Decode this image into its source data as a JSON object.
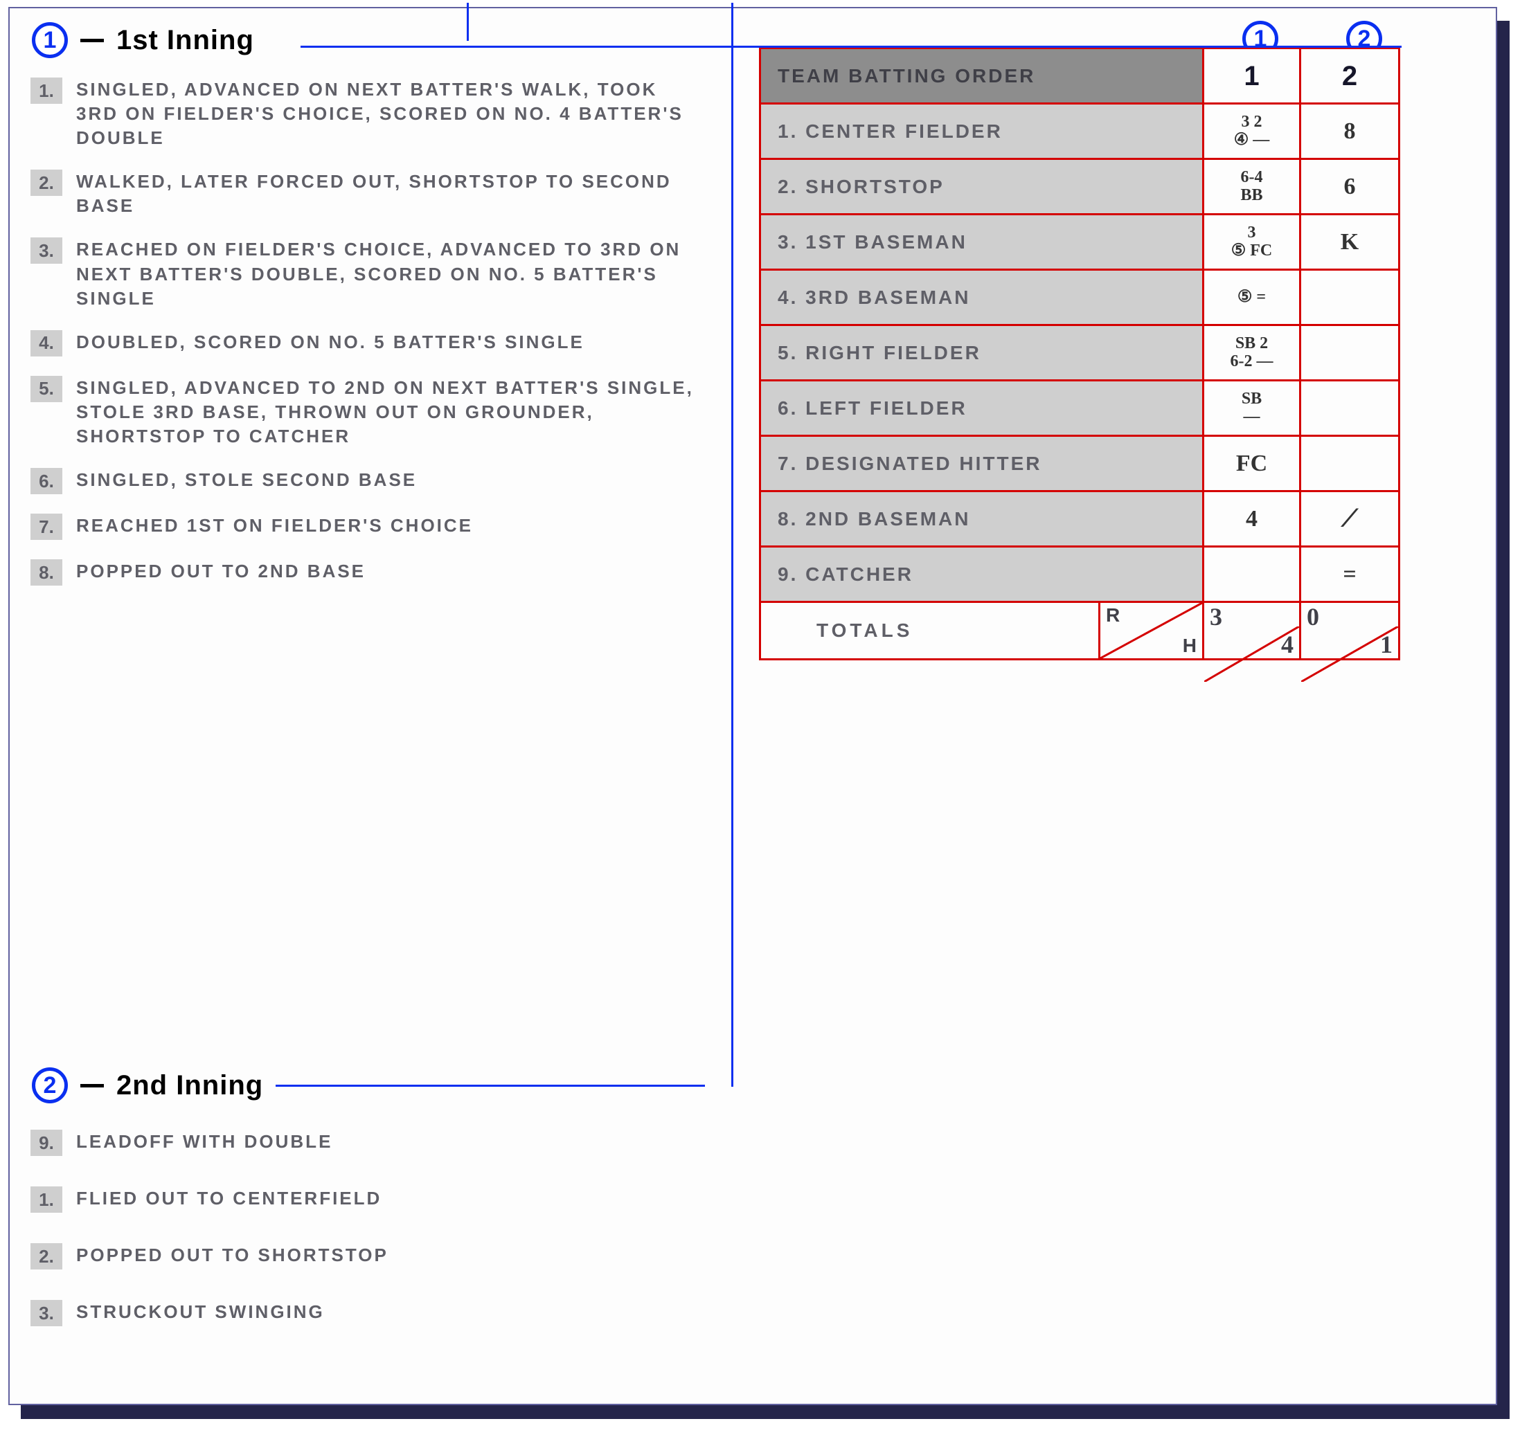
{
  "innings": [
    {
      "badge": "1",
      "title": "1st Inning",
      "plays": [
        {
          "n": "1.",
          "t": "SINGLED, ADVANCED ON NEXT BATTER'S WALK, TOOK 3RD ON FIELDER'S CHOICE, SCORED ON NO. 4 BATTER'S DOUBLE"
        },
        {
          "n": "2.",
          "t": "WALKED, LATER FORCED OUT, SHORTSTOP TO SECOND BASE"
        },
        {
          "n": "3.",
          "t": "REACHED ON FIELDER'S CHOICE, ADVANCED TO 3RD ON NEXT BATTER'S DOUBLE, SCORED ON NO. 5 BATTER'S SINGLE"
        },
        {
          "n": "4.",
          "t": "DOUBLED, SCORED ON NO. 5 BATTER'S SINGLE"
        },
        {
          "n": "5.",
          "t": "SINGLED, ADVANCED TO 2ND ON NEXT BATTER'S SINGLE, STOLE 3RD BASE, THROWN OUT ON GROUNDER, SHORTSTOP TO CATCHER"
        },
        {
          "n": "6.",
          "t": "SINGLED, STOLE SECOND BASE"
        },
        {
          "n": "7.",
          "t": "REACHED 1ST ON FIELDER'S CHOICE"
        },
        {
          "n": "8.",
          "t": "POPPED OUT TO 2ND BASE"
        }
      ]
    },
    {
      "badge": "2",
      "title": "2nd Inning",
      "plays": [
        {
          "n": "9.",
          "t": "LEADOFF WITH DOUBLE"
        },
        {
          "n": "1.",
          "t": "FLIED OUT TO CENTERFIELD"
        },
        {
          "n": "2.",
          "t": "POPPED OUT TO SHORTSTOP"
        },
        {
          "n": "3.",
          "t": "STRUCKOUT SWINGING"
        }
      ]
    }
  ],
  "scorecard": {
    "header": {
      "label": "TEAM BATTING ORDER",
      "cols": [
        "1",
        "2"
      ]
    },
    "rows": [
      {
        "label": "1.  CENTER FIELDER",
        "c1": "3  2\n④  —",
        "c2": "8"
      },
      {
        "label": "2.  SHORTSTOP",
        "c1": "6-4\nBB",
        "c2": "6"
      },
      {
        "label": "3.  1ST BASEMAN",
        "c1": "3\n⑤  FC",
        "c2": "K"
      },
      {
        "label": "4.  3RD BASEMAN",
        "c1": "⑤    =",
        "c2": ""
      },
      {
        "label": "5.  RIGHT FIELDER",
        "c1": "SB 2\n6-2 —",
        "c2": ""
      },
      {
        "label": "6.  LEFT FIELDER",
        "c1": "SB\n—",
        "c2": ""
      },
      {
        "label": "7.  DESIGNATED HITTER",
        "c1": "FC",
        "c2": ""
      },
      {
        "label": "8.  2ND BASEMAN",
        "c1": "4",
        "c2": "⟋"
      },
      {
        "label": "9.  CATCHER",
        "c1": "",
        "c2": "="
      }
    ],
    "totals": {
      "label": "TOTALS",
      "rh": {
        "tl": "R",
        "br": "H"
      },
      "col1": {
        "tl": "3",
        "br": "4"
      },
      "col2": {
        "tl": "0",
        "br": "1"
      }
    },
    "topBadges": [
      "1",
      "2"
    ]
  }
}
